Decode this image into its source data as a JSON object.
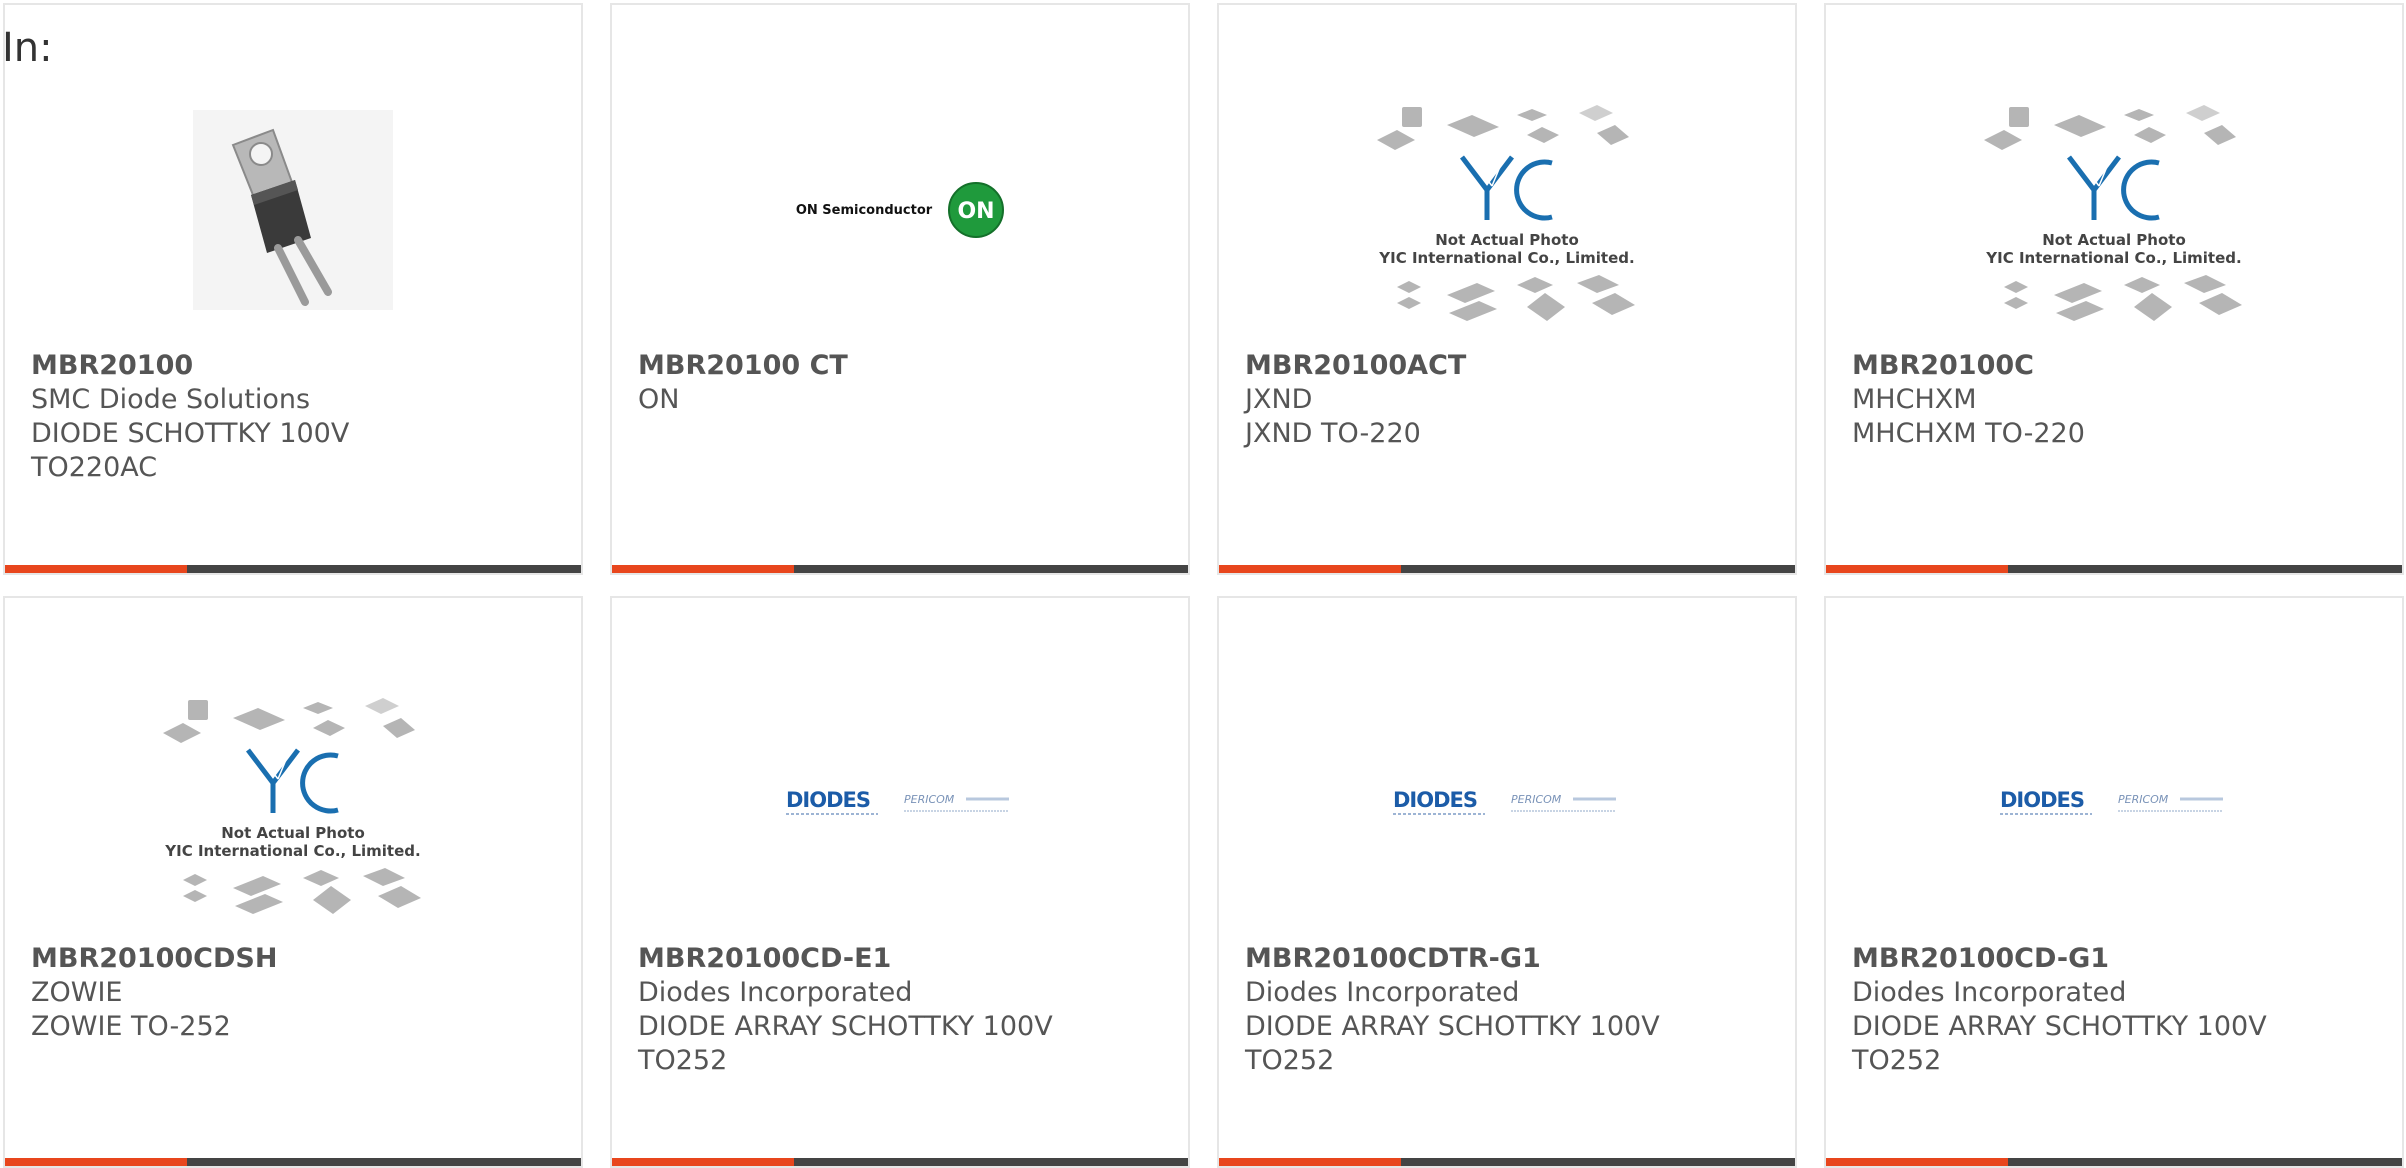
{
  "header": {
    "label": "In:"
  },
  "colors": {
    "accent": "#e8461d",
    "bar": "#444444",
    "text": "#555555",
    "yic_blue": "#1a6fb0",
    "on_green": "#1f9a3c",
    "diodes_blue": "#1c5ca8"
  },
  "cards": [
    {
      "part": "MBR20100",
      "manufacturer": "SMC Diode Solutions",
      "desc1": "DIODE SCHOTTKY 100V",
      "desc2": "TO220AC",
      "image": "to220-package-photo"
    },
    {
      "part": "MBR20100 CT",
      "manufacturer": "ON",
      "desc1": "",
      "desc2": "",
      "image": "on-semiconductor-logo",
      "logo_text": "ON Semiconductor",
      "logo_badge": "ON"
    },
    {
      "part": "MBR20100ACT",
      "manufacturer": "JXND",
      "desc1": "JXND TO-220",
      "desc2": "",
      "image": "yic-placeholder",
      "logo_line1": "Not Actual Photo",
      "logo_line2": "YIC International Co., Limited."
    },
    {
      "part": "MBR20100C",
      "manufacturer": "MHCHXM",
      "desc1": "MHCHXM TO-220",
      "desc2": "",
      "image": "yic-placeholder",
      "logo_line1": "Not Actual Photo",
      "logo_line2": "YIC International Co., Limited."
    },
    {
      "part": "MBR20100CDSH",
      "manufacturer": "ZOWIE",
      "desc1": "ZOWIE TO-252",
      "desc2": "",
      "image": "yic-placeholder",
      "logo_line1": "Not Actual Photo",
      "logo_line2": "YIC International Co., Limited."
    },
    {
      "part": "MBR20100CD-E1",
      "manufacturer": "Diodes Incorporated",
      "desc1": "DIODE ARRAY SCHOTTKY 100V",
      "desc2": "TO252",
      "image": "diodes-pericom-logo",
      "logo_text": "DIODES",
      "logo_sub": "PERICOM"
    },
    {
      "part": "MBR20100CDTR-G1",
      "manufacturer": "Diodes Incorporated",
      "desc1": "DIODE ARRAY SCHOTTKY 100V",
      "desc2": "TO252",
      "image": "diodes-pericom-logo",
      "logo_text": "DIODES",
      "logo_sub": "PERICOM"
    },
    {
      "part": "MBR20100CD-G1",
      "manufacturer": "Diodes Incorporated",
      "desc1": "DIODE ARRAY SCHOTTKY 100V",
      "desc2": "TO252",
      "image": "diodes-pericom-logo",
      "logo_text": "DIODES",
      "logo_sub": "PERICOM"
    }
  ]
}
